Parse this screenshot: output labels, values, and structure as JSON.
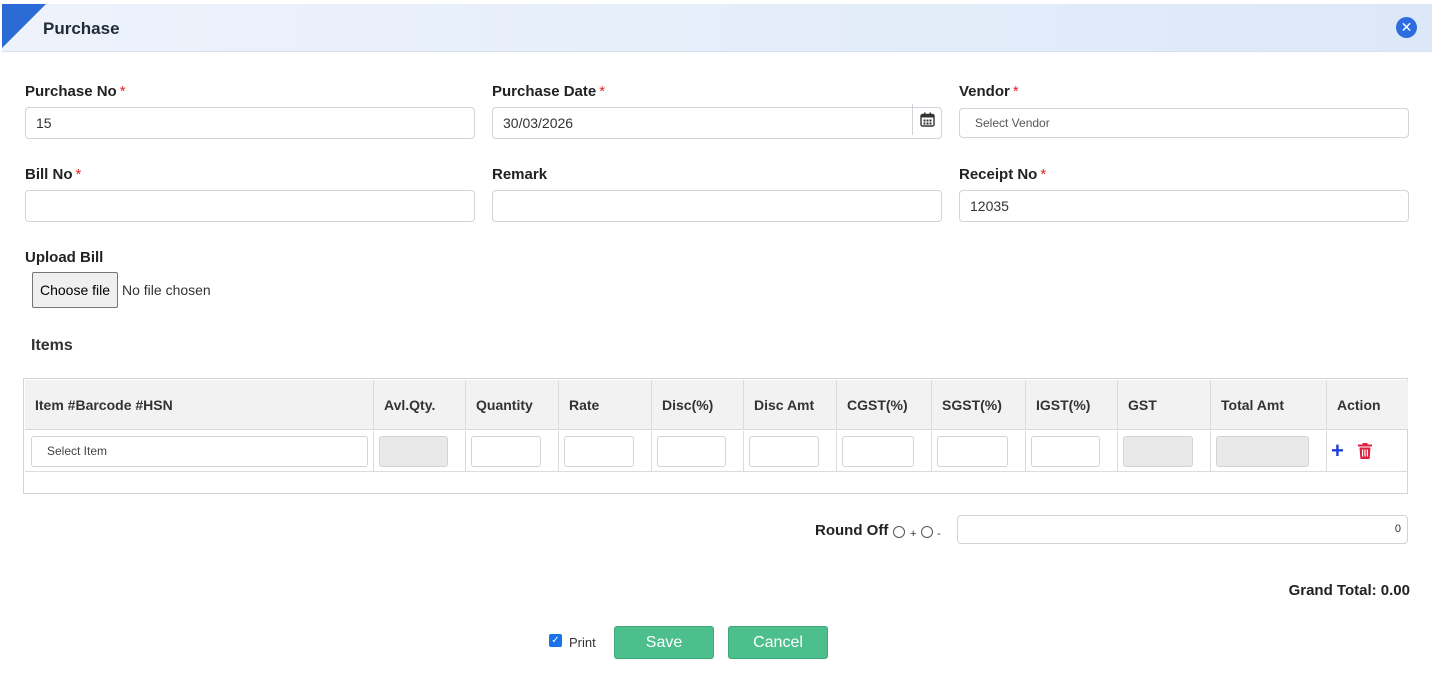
{
  "modal": {
    "title": "Purchase"
  },
  "form": {
    "purchase_no": {
      "label": "Purchase No",
      "required": "*",
      "value": "15"
    },
    "purchase_date": {
      "label": "Purchase Date",
      "required": "*",
      "value": "30/03/2026"
    },
    "vendor": {
      "label": "Vendor",
      "required": "*",
      "placeholder": "Select Vendor"
    },
    "bill_no": {
      "label": "Bill No",
      "required": "*",
      "value": ""
    },
    "remark": {
      "label": "Remark",
      "value": ""
    },
    "receipt_no": {
      "label": "Receipt No",
      "required": "*",
      "value": "12035"
    },
    "upload_bill": {
      "label": "Upload Bill",
      "button": "Choose file",
      "status": "No file chosen"
    }
  },
  "items": {
    "title": "Items",
    "columns": [
      "Item #Barcode #HSN",
      "Avl.Qty.",
      "Quantity",
      "Rate",
      "Disc(%)",
      "Disc Amt",
      "CGST(%)",
      "SGST(%)",
      "IGST(%)",
      "GST",
      "Total Amt",
      "Action"
    ],
    "row": {
      "item_placeholder": "Select Item"
    }
  },
  "round_off": {
    "label": "Round Off",
    "plus": "+",
    "minus": "-",
    "value": "0"
  },
  "grand_total": {
    "text": "Grand Total: 0.00"
  },
  "footer": {
    "print_label": "Print",
    "print_checked": true,
    "save": "Save",
    "cancel": "Cancel"
  },
  "colors": {
    "accent": "#2b6bd6",
    "button": "#4cbf8d",
    "required": "#e02424",
    "delete": "#e0213e"
  }
}
